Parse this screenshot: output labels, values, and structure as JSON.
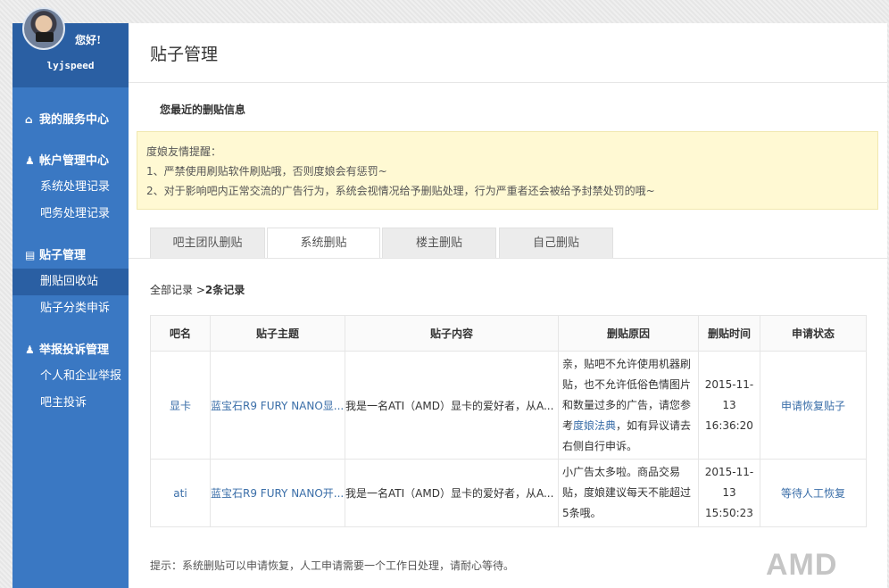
{
  "sidebar": {
    "greeting": "您好!",
    "username": "lyjspeed",
    "groups": [
      {
        "icon": "home-icon",
        "label": "我的服务中心",
        "items": []
      },
      {
        "icon": "user-icon",
        "label": "帐户管理中心",
        "items": [
          "系统处理记录",
          "吧务处理记录"
        ]
      },
      {
        "icon": "document-icon",
        "label": "贴子管理",
        "items": [
          "删贴回收站",
          "贴子分类申诉"
        ]
      },
      {
        "icon": "users-icon",
        "label": "举报投诉管理",
        "items": [
          "个人和企业举报",
          "吧主投诉"
        ]
      }
    ],
    "active_item": "删贴回收站"
  },
  "main": {
    "title": "贴子管理",
    "subhead": "您最近的删贴信息",
    "tips": {
      "heading": "度娘友情提醒：",
      "lines": [
        "1、严禁使用刷贴软件刷贴哦，否则度娘会有惩罚~",
        "2、对于影响吧内正常交流的广告行为，系统会视情况给予删贴处理，行为严重者还会被给予封禁处罚的哦~"
      ]
    },
    "tabs": [
      "吧主团队删贴",
      "系统删贴",
      "楼主删贴",
      "自己删贴"
    ],
    "active_tab": "系统删贴",
    "summary": {
      "prefix": "全部记录 >",
      "count": "2条记录"
    },
    "table": {
      "headers": [
        "吧名",
        "贴子主题",
        "贴子内容",
        "删贴原因",
        "删贴时间",
        "申请状态"
      ],
      "rows": [
        {
          "bar": "显卡",
          "title": "蓝宝石R9 FURY NANO显...",
          "content": "我是一名ATI（AMD）显卡的爱好者，从A...",
          "reason_pre": "亲，贴吧不允许使用机器刷贴，也不允许低俗色情图片和数量过多的广告，请您参考",
          "reason_link": "度娘法典",
          "reason_post": "，如有异议请去右侧自行申诉。",
          "date": "2015-11-13",
          "time": "16:36:20",
          "status": "申请恢复贴子"
        },
        {
          "bar": "ati",
          "title": "蓝宝石R9 FURY NANO开...",
          "content": "我是一名ATI（AMD）显卡的爱好者，从A...",
          "reason_pre": "小广告太多啦。商品交易贴，度娘建议每天不能超过5条哦。",
          "reason_link": "",
          "reason_post": "",
          "date": "2015-11-13",
          "time": "15:50:23",
          "status": "等待人工恢复"
        }
      ]
    },
    "footnote": "提示：系统删贴可以申请恢复，人工申请需要一个工作日处理，请耐心等待。"
  },
  "watermark": "AMD"
}
